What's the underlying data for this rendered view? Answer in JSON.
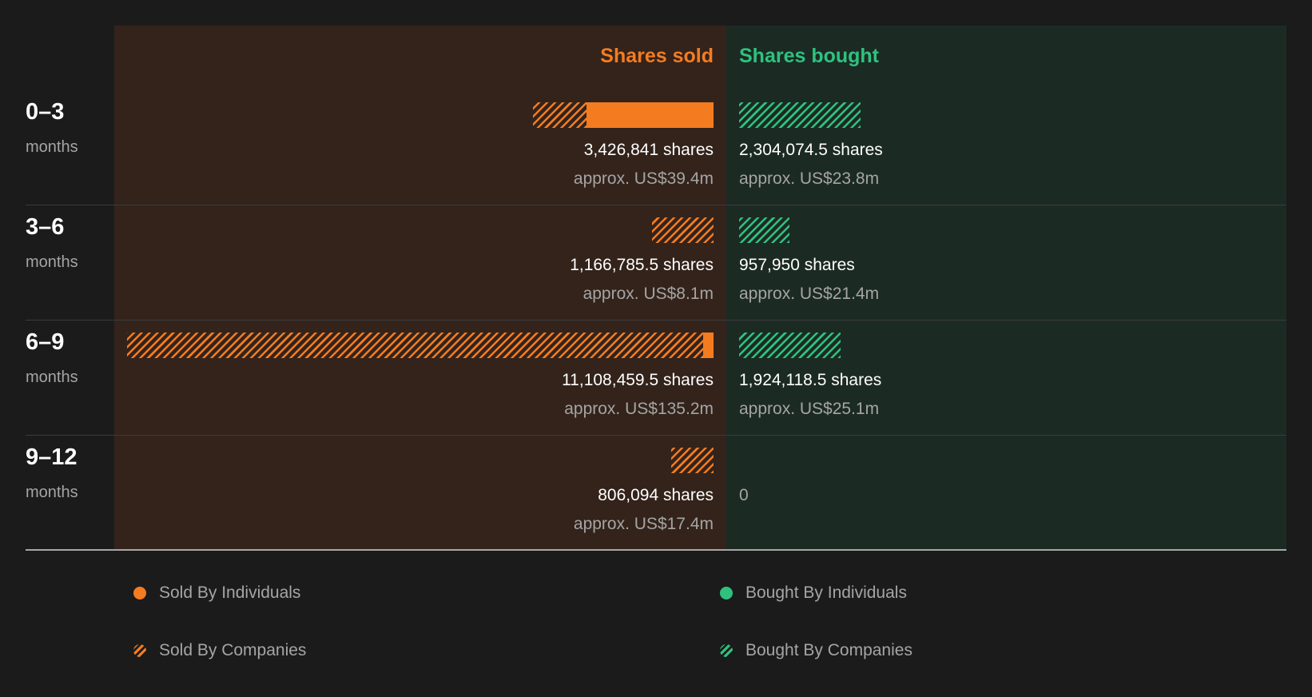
{
  "chart_data": {
    "type": "bar",
    "headers": {
      "sold": "Shares sold",
      "bought": "Shares bought"
    },
    "colors": {
      "sold": "#f47c20",
      "bought": "#2ec27e"
    },
    "categories": [
      {
        "range": "0–3",
        "unit": "months"
      },
      {
        "range": "3–6",
        "unit": "months"
      },
      {
        "range": "6–9",
        "unit": "months"
      },
      {
        "range": "9–12",
        "unit": "months"
      }
    ],
    "series": [
      {
        "name": "Sold By Individuals",
        "side": "sold",
        "style": "solid",
        "values": [
          2400000,
          0,
          200000,
          0
        ]
      },
      {
        "name": "Sold By Companies",
        "side": "sold",
        "style": "hatched",
        "values": [
          1026841,
          1166785.5,
          10908459.5,
          806094
        ]
      },
      {
        "name": "Bought By Individuals",
        "side": "bought",
        "style": "solid",
        "values": [
          0,
          0,
          0,
          0
        ]
      },
      {
        "name": "Bought By Companies",
        "side": "bought",
        "style": "hatched",
        "values": [
          2304074.5,
          957950,
          1924118.5,
          0
        ]
      }
    ],
    "sold_labels": [
      {
        "shares": "3,426,841 shares",
        "approx": "approx. US$39.4m"
      },
      {
        "shares": "1,166,785.5 shares",
        "approx": "approx. US$8.1m"
      },
      {
        "shares": "11,108,459.5 shares",
        "approx": "approx. US$135.2m"
      },
      {
        "shares": "806,094 shares",
        "approx": "approx. US$17.4m"
      }
    ],
    "bought_labels": [
      {
        "shares": "2,304,074.5 shares",
        "approx": "approx. US$23.8m"
      },
      {
        "shares": "957,950 shares",
        "approx": "approx. US$21.4m"
      },
      {
        "shares": "1,924,118.5 shares",
        "approx": "approx. US$25.1m"
      },
      {
        "shares": "0",
        "approx": ""
      }
    ],
    "max_value": 11108459.5,
    "legend": [
      {
        "label": "Sold By Individuals",
        "color": "#f47c20",
        "style": "solid"
      },
      {
        "label": "Bought By Individuals",
        "color": "#2ec27e",
        "style": "solid"
      },
      {
        "label": "Sold By Companies",
        "color": "#f47c20",
        "style": "hatched"
      },
      {
        "label": "Bought By Companies",
        "color": "#2ec27e",
        "style": "hatched"
      }
    ]
  }
}
